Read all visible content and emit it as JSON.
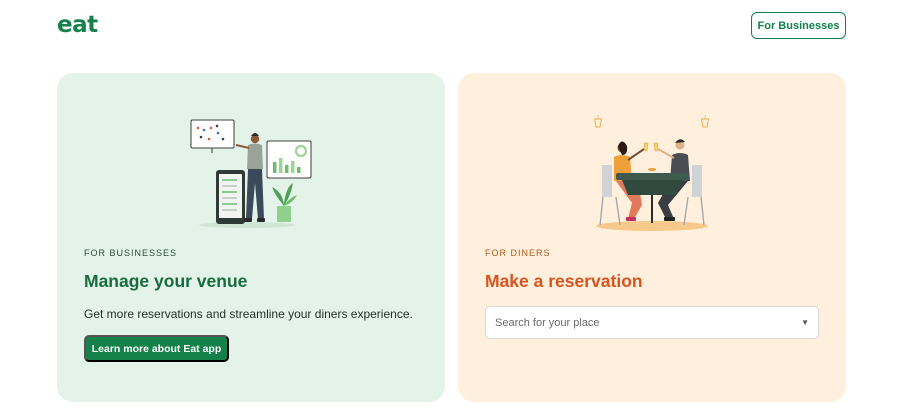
{
  "header": {
    "logo": "eat",
    "for_businesses_button": "For Businesses"
  },
  "cards": {
    "business": {
      "eyebrow": "FOR BUSINESSES",
      "heading": "Manage your venue",
      "description": "Get more reservations and streamline your diners experience.",
      "cta": "Learn more about Eat app"
    },
    "diners": {
      "eyebrow": "FOR DINERS",
      "heading": "Make a reservation",
      "search_placeholder": "Search for your place"
    }
  },
  "colors": {
    "brand_green": "#14804a",
    "business_card_bg": "#e3f3e9",
    "diners_card_bg": "#fef0dd",
    "diners_accent": "#d9531e"
  },
  "icons": {
    "dropdown": "chevron-down-icon"
  }
}
